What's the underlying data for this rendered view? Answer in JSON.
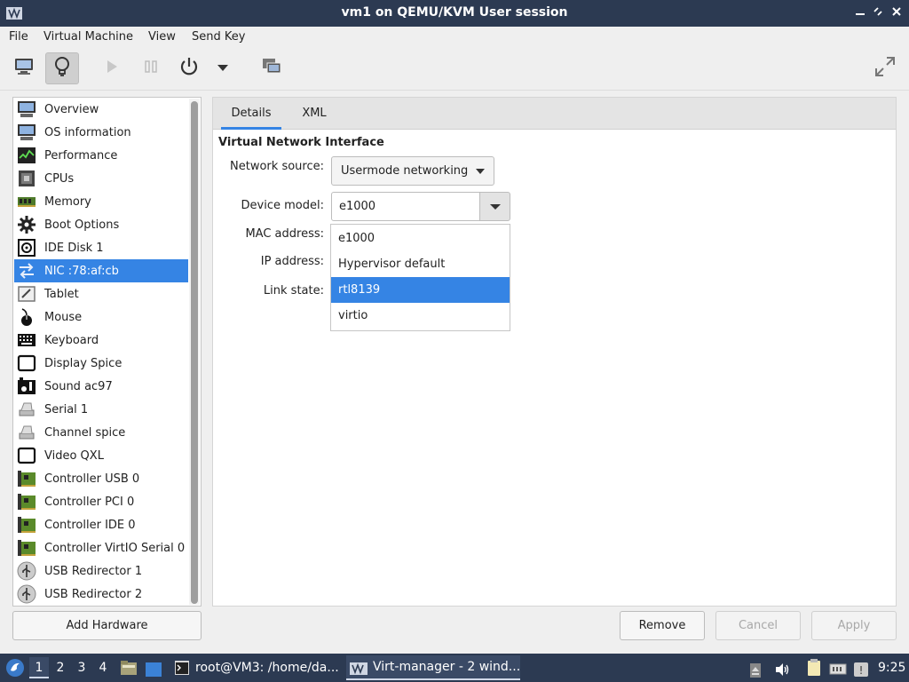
{
  "window": {
    "title": "vm1 on QEMU/KVM User session",
    "controls": [
      "minimize",
      "maximize",
      "close"
    ]
  },
  "menubar": {
    "items": [
      "File",
      "Virtual Machine",
      "View",
      "Send Key"
    ]
  },
  "toolbar": {
    "buttons": [
      "console-icon",
      "details-icon",
      "run-icon",
      "pause-icon",
      "power-icon",
      "power-menu-icon",
      "snapshots-icon",
      "fullscreen-icon"
    ]
  },
  "sidebar": {
    "items": [
      {
        "label": "Overview",
        "icon": "monitor-icon"
      },
      {
        "label": "OS information",
        "icon": "monitor-icon"
      },
      {
        "label": "Performance",
        "icon": "performance-icon"
      },
      {
        "label": "CPUs",
        "icon": "cpu-icon"
      },
      {
        "label": "Memory",
        "icon": "memory-icon"
      },
      {
        "label": "Boot Options",
        "icon": "gear-icon"
      },
      {
        "label": "IDE Disk 1",
        "icon": "disk-icon"
      },
      {
        "label": "NIC :78:af:cb",
        "icon": "network-icon",
        "selected": true
      },
      {
        "label": "Tablet",
        "icon": "tablet-icon"
      },
      {
        "label": "Mouse",
        "icon": "mouse-icon"
      },
      {
        "label": "Keyboard",
        "icon": "keyboard-icon"
      },
      {
        "label": "Display Spice",
        "icon": "display-icon"
      },
      {
        "label": "Sound ac97",
        "icon": "sound-icon"
      },
      {
        "label": "Serial 1",
        "icon": "serial-icon"
      },
      {
        "label": "Channel spice",
        "icon": "channel-icon"
      },
      {
        "label": "Video QXL",
        "icon": "video-icon"
      },
      {
        "label": "Controller USB 0",
        "icon": "controller-icon"
      },
      {
        "label": "Controller PCI 0",
        "icon": "controller-icon"
      },
      {
        "label": "Controller IDE 0",
        "icon": "controller-icon"
      },
      {
        "label": "Controller VirtIO Serial 0",
        "icon": "controller-icon"
      },
      {
        "label": "USB Redirector 1",
        "icon": "usb-icon"
      },
      {
        "label": "USB Redirector 2",
        "icon": "usb-icon"
      }
    ],
    "add_hardware_label": "Add Hardware"
  },
  "tabs": [
    "Details",
    "XML"
  ],
  "details": {
    "section_title": "Virtual Network Interface",
    "network_source_label": "Network source:",
    "network_source_value": "Usermode networking",
    "device_model_label": "Device model:",
    "device_model_value": "e1000",
    "mac_label": "MAC address:",
    "ip_label": "IP address:",
    "link_state_label": "Link state:",
    "model_options": [
      "e1000",
      "Hypervisor default",
      "rtl8139",
      "virtio"
    ],
    "highlighted_option": "rtl8139"
  },
  "buttons": {
    "remove": "Remove",
    "cancel": "Cancel",
    "apply": "Apply"
  },
  "taskbar": {
    "workspaces": [
      "1",
      "2",
      "3",
      "4"
    ],
    "active_workspace": "1",
    "tasks": [
      {
        "label": "root@VM3: /home/da...",
        "icon": "terminal-icon"
      },
      {
        "label": "Virt-manager - 2 wind...",
        "icon": "virt-manager-icon",
        "active": true
      }
    ],
    "clock": "9:25"
  },
  "colors": {
    "titlebar": "#2c3a52",
    "selection": "#3584e4"
  }
}
